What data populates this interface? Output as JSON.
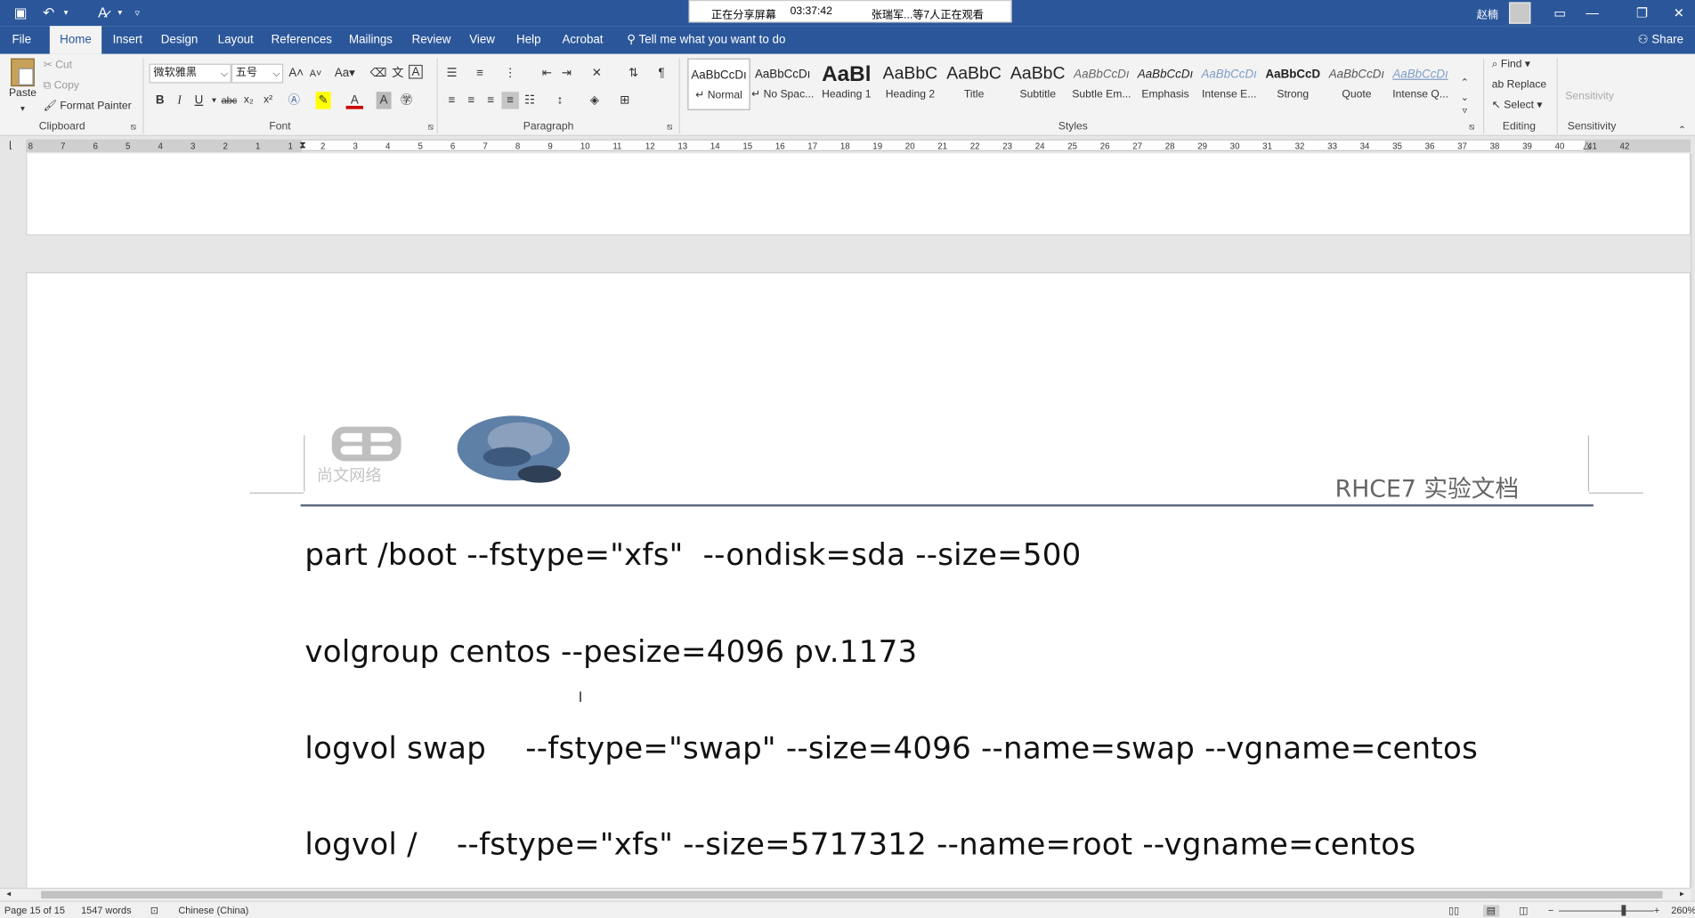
{
  "titlebar": {
    "share_banner_left": "正在分享屏幕",
    "share_banner_time": "03:37:42",
    "share_banner_right": "张瑞军...等7人正在观看",
    "user_name": "赵楠"
  },
  "tabs": [
    "File",
    "Home",
    "Insert",
    "Design",
    "Layout",
    "References",
    "Mailings",
    "Review",
    "View",
    "Help",
    "Acrobat"
  ],
  "active_tab": "Home",
  "tell_me": "Tell me what you want to do",
  "share_label": "Share",
  "clipboard": {
    "paste": "Paste",
    "cut": "Cut",
    "copy": "Copy",
    "format_painter": "Format Painter",
    "group_label": "Clipboard"
  },
  "font": {
    "family": "微软雅黑",
    "size": "五号",
    "group_label": "Font",
    "change_case": "Aa"
  },
  "paragraph": {
    "group_label": "Paragraph"
  },
  "styles": {
    "group_label": "Styles",
    "items": [
      {
        "preview": "AaBbCcDı",
        "name": "↵ Normal"
      },
      {
        "preview": "AaBbCcDı",
        "name": "↵ No Spac..."
      },
      {
        "preview": "AaBl",
        "name": "Heading 1"
      },
      {
        "preview": "AaBbC",
        "name": "Heading 2"
      },
      {
        "preview": "AaBbC",
        "name": "Title"
      },
      {
        "preview": "AaBbC",
        "name": "Subtitle"
      },
      {
        "preview": "AaBbCcDı",
        "name": "Subtle Em..."
      },
      {
        "preview": "AaBbCcDı",
        "name": "Emphasis"
      },
      {
        "preview": "AaBbCcDı",
        "name": "Intense E..."
      },
      {
        "preview": "AaBbCcD",
        "name": "Strong"
      },
      {
        "preview": "AaBbCcDı",
        "name": "Quote"
      },
      {
        "preview": "AaBbCcDı",
        "name": "Intense Q..."
      }
    ]
  },
  "editing": {
    "group_label": "Editing",
    "find": "Find",
    "replace": "Replace",
    "select": "Select"
  },
  "sensitivity": {
    "group_label": "Sensitivity",
    "button": "Sensitivity"
  },
  "ruler": {
    "labels": [
      "8",
      "7",
      "6",
      "5",
      "4",
      "3",
      "2",
      "1",
      "1",
      "2",
      "3",
      "4",
      "5",
      "6",
      "7",
      "8",
      "9",
      "10",
      "11",
      "12",
      "13",
      "14",
      "15",
      "16",
      "17",
      "18",
      "19",
      "20",
      "21",
      "22",
      "23",
      "24",
      "25",
      "26",
      "27",
      "28",
      "29",
      "30",
      "31",
      "32",
      "33",
      "34",
      "35",
      "36",
      "37",
      "38",
      "39",
      "40",
      "41",
      "42"
    ]
  },
  "document": {
    "header_title": "RHCE7  实验文档",
    "logo_left_text": "尚文网络",
    "lines": [
      "part /boot --fstype=\"xfs\"  --ondisk=sda --size=500",
      "volgroup centos --pesize=4096 pv.1173",
      "logvol swap    --fstype=\"swap\" --size=4096 --name=swap --vgname=centos",
      "logvol /    --fstype=\"xfs\" --size=5717312 --name=root --vgname=centos"
    ]
  },
  "status": {
    "page": "Page 15 of 15",
    "words": "1547 words",
    "language": "Chinese (China)",
    "zoom": "260%"
  }
}
